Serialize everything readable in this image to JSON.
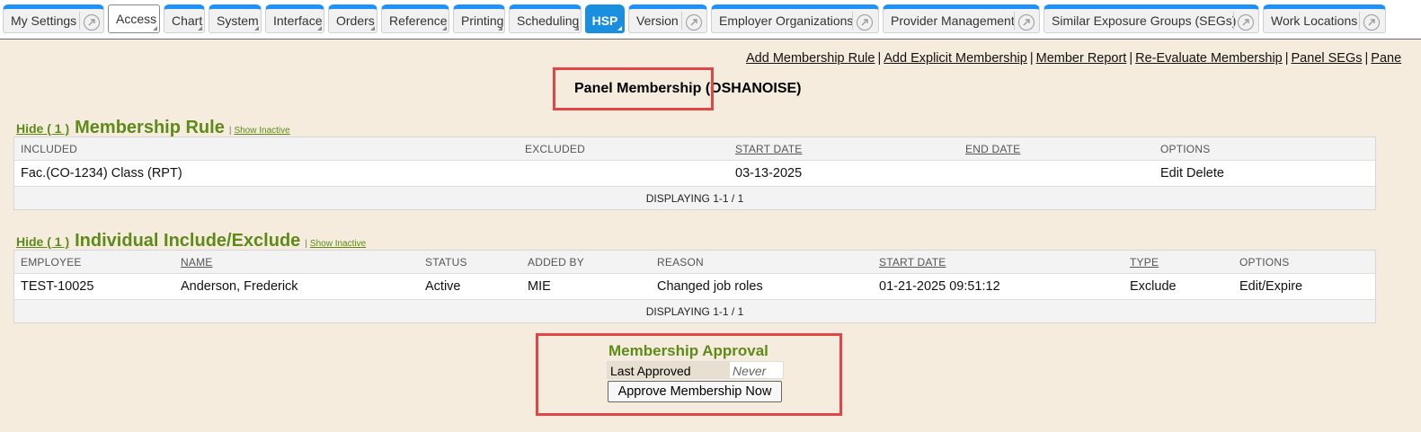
{
  "tabs": [
    {
      "label": "My Settings",
      "ext": true
    },
    {
      "label": "Access"
    },
    {
      "label": "Chart"
    },
    {
      "label": "System"
    },
    {
      "label": "Interface"
    },
    {
      "label": "Orders"
    },
    {
      "label": "Reference"
    },
    {
      "label": "Printing"
    },
    {
      "label": "Scheduling"
    },
    {
      "label": "HSP",
      "active": true
    },
    {
      "label": "Version",
      "ext": true
    },
    {
      "label": "Employer Organizations",
      "ext": true
    },
    {
      "label": "Provider Management",
      "ext": true
    },
    {
      "label": "Similar Exposure Groups (SEGs)",
      "ext": true
    },
    {
      "label": "Work Locations",
      "ext": true
    }
  ],
  "top_links": [
    "Add Membership Rule",
    "Add Explicit Membership",
    "Member Report",
    "Re-Evaluate Membership",
    "Panel SEGs",
    "Pane"
  ],
  "page_title": "Panel Membership (OSHANOISE)",
  "membership_rule": {
    "hide_label": "Hide ( 1 )",
    "title": "Membership Rule",
    "show_inactive": "Show Inactive",
    "columns": [
      "INCLUDED",
      "EXCLUDED",
      "START DATE",
      "END DATE",
      "OPTIONS"
    ],
    "row": {
      "included": "Fac.(CO-1234) Class (RPT)",
      "excluded": "",
      "start_date": "03-13-2025",
      "end_date": "",
      "edit": "Edit",
      "delete": "Delete"
    },
    "footer": "DISPLAYING 1-1 / 1"
  },
  "individual": {
    "hide_label": "Hide ( 1 )",
    "title": "Individual Include/Exclude",
    "show_inactive": "Show Inactive",
    "columns": [
      "EMPLOYEE",
      "NAME",
      "STATUS",
      "ADDED BY",
      "REASON",
      "START DATE",
      "TYPE",
      "OPTIONS"
    ],
    "row": {
      "employee": "TEST-10025",
      "name": "Anderson, Frederick",
      "status": "Active",
      "added_by": "MIE",
      "reason": "Changed job roles",
      "start_date": "01-21-2025 09:51:12",
      "type": "Exclude",
      "options": "Edit/Expire"
    },
    "footer": "DISPLAYING 1-1 / 1"
  },
  "approval": {
    "title": "Membership Approval",
    "last_approved_label": "Last Approved",
    "last_approved_value": "Never",
    "button": "Approve Membership Now"
  },
  "colors": {
    "accent_tab": "#1a8fe0",
    "section_title": "#5e8a1a",
    "highlight": "#e24545",
    "background": "#f5ecdd"
  }
}
